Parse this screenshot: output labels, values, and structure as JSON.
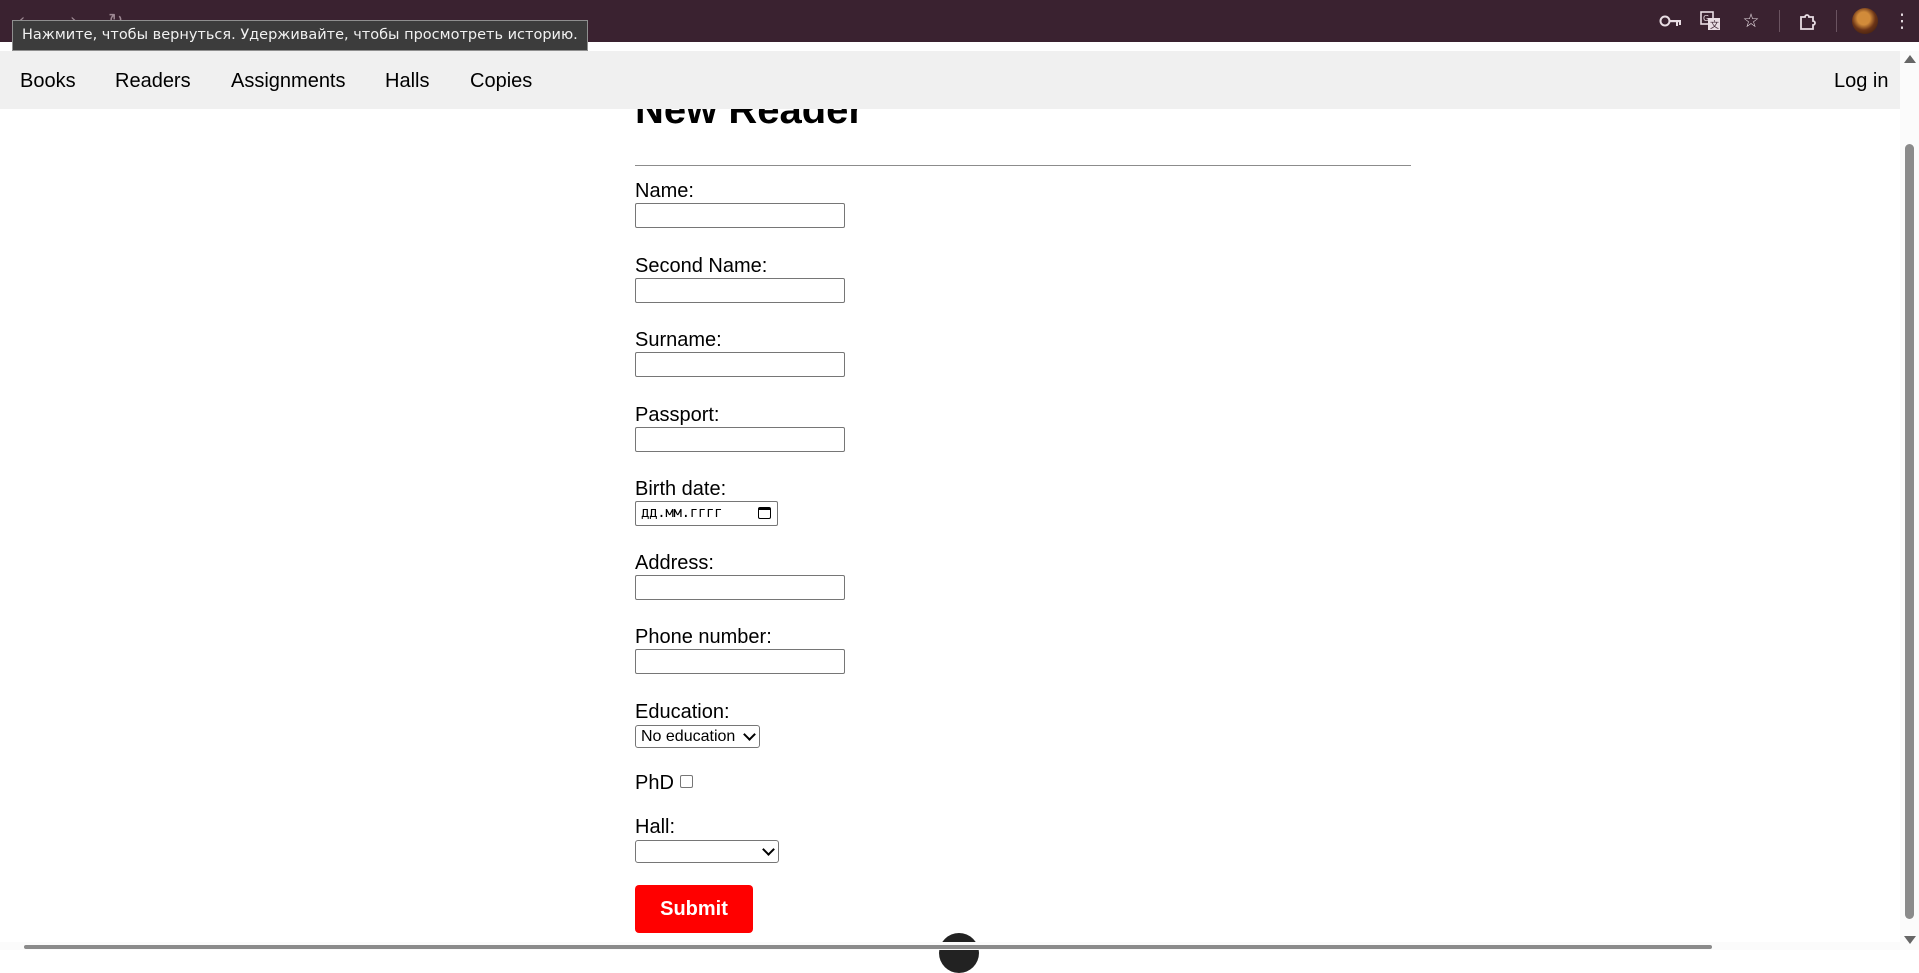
{
  "browser": {
    "back_tooltip": "Нажмите, чтобы вернуться. Удерживайте, чтобы просмотреть историю.",
    "icons": [
      "key-icon",
      "translate-icon",
      "star-icon",
      "extensions-icon",
      "profile-avatar",
      "menu-dots-icon"
    ]
  },
  "nav": {
    "links": [
      "Books",
      "Readers",
      "Assignments",
      "Halls",
      "Copies"
    ],
    "login": "Log in"
  },
  "form": {
    "title": "New Reader",
    "name_label": "Name:",
    "second_name_label": "Second Name:",
    "surname_label": "Surname:",
    "passport_label": "Passport:",
    "birth_date_label": "Birth date:",
    "birth_date_placeholder": "дд.мм.гггг",
    "address_label": "Address:",
    "phone_label": "Phone number:",
    "education_label": "Education:",
    "education_value": "No education",
    "phd_label": "PhD",
    "phd_checked": false,
    "hall_label": "Hall:",
    "hall_value": "",
    "submit_label": "Submit"
  },
  "colors": {
    "accent": "#ff0000",
    "navbar_bg": "#f0f0f0",
    "chrome_bg": "#3a2230"
  }
}
